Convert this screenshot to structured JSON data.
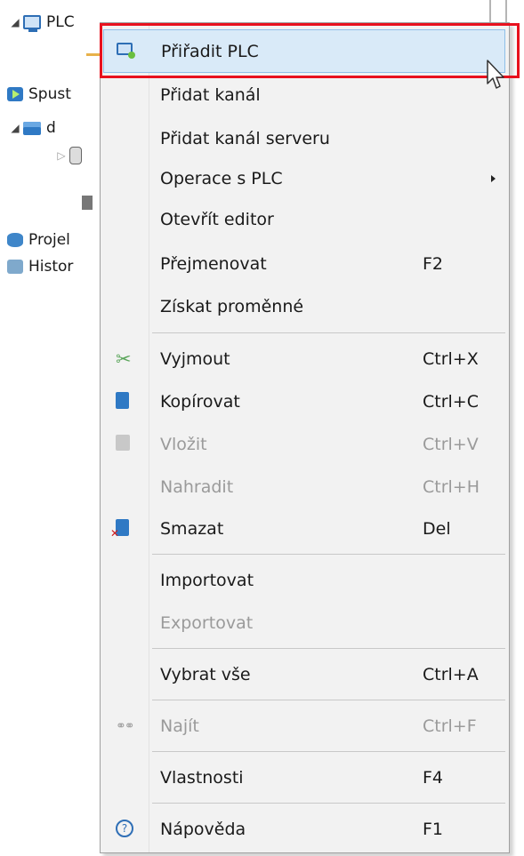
{
  "tree": {
    "plc_label": "PLC",
    "spustit_label": "Spust",
    "folder_label": "d",
    "projekt_label": "Projel",
    "historie_label": "Histor"
  },
  "menu": {
    "items": [
      {
        "label": "Přiřadit PLC",
        "shortcut": "",
        "icon": "plc-assign-icon",
        "state": "highlighted"
      },
      {
        "label": "Přidat kanál",
        "shortcut": "",
        "icon": "",
        "state": "enabled"
      },
      {
        "label": "Přidat kanál serveru",
        "shortcut": "",
        "icon": "",
        "state": "enabled"
      },
      {
        "label": "Operace s PLC",
        "shortcut": "",
        "icon": "",
        "state": "enabled",
        "submenu": true
      },
      {
        "label": "Otevřít editor",
        "shortcut": "",
        "icon": "",
        "state": "enabled"
      },
      {
        "label": "Přejmenovat",
        "shortcut": "F2",
        "icon": "",
        "state": "enabled"
      },
      {
        "label": "Získat proměnné",
        "shortcut": "",
        "icon": "",
        "state": "enabled"
      },
      {
        "label": "Vyjmout",
        "shortcut": "Ctrl+X",
        "icon": "scissors-icon",
        "state": "enabled"
      },
      {
        "label": "Kopírovat",
        "shortcut": "Ctrl+C",
        "icon": "copy-icon",
        "state": "enabled"
      },
      {
        "label": "Vložit",
        "shortcut": "Ctrl+V",
        "icon": "paste-icon",
        "state": "disabled"
      },
      {
        "label": "Nahradit",
        "shortcut": "Ctrl+H",
        "icon": "",
        "state": "disabled"
      },
      {
        "label": "Smazat",
        "shortcut": "Del",
        "icon": "delete-icon",
        "state": "enabled"
      },
      {
        "label": "Importovat",
        "shortcut": "",
        "icon": "",
        "state": "enabled"
      },
      {
        "label": "Exportovat",
        "shortcut": "",
        "icon": "",
        "state": "disabled"
      },
      {
        "label": "Vybrat vše",
        "shortcut": "Ctrl+A",
        "icon": "",
        "state": "enabled"
      },
      {
        "label": "Najít",
        "shortcut": "Ctrl+F",
        "icon": "binoculars-icon",
        "state": "disabled"
      },
      {
        "label": "Vlastnosti",
        "shortcut": "F4",
        "icon": "",
        "state": "enabled"
      },
      {
        "label": "Nápověda",
        "shortcut": "F1",
        "icon": "help-icon",
        "state": "enabled"
      }
    ]
  },
  "colors": {
    "highlight_outline": "#e8111e",
    "menu_background": "#f2f2f2",
    "disabled_text": "#9a9a9a",
    "accent_blue": "#2f79c4"
  }
}
